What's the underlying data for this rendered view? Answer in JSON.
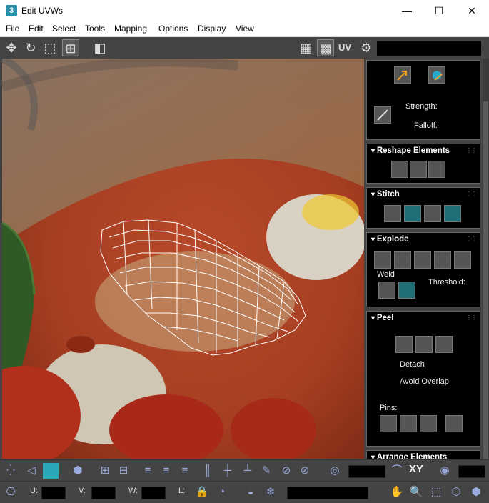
{
  "window": {
    "title": "Edit UVWs",
    "app_icon": "3",
    "minimize": "—",
    "maximize": "☐",
    "close": "✕"
  },
  "menu": [
    "File",
    "Edit",
    "Select",
    "Tools",
    "Mapping",
    "Options",
    "Display",
    "View"
  ],
  "toolbar": {
    "uv_label": "UV"
  },
  "panel": {
    "brush": {
      "strength": "Strength:",
      "falloff": "Falloff:"
    },
    "reshape": {
      "title": "Reshape Elements"
    },
    "stitch": {
      "title": "Stitch"
    },
    "explode": {
      "title": "Explode",
      "weld": "Weld",
      "threshold": "Threshold:"
    },
    "peel": {
      "title": "Peel",
      "detach": "Detach",
      "avoid_overlap": "Avoid Overlap",
      "pins": "Pins:"
    },
    "arrange": {
      "title": "Arrange Elements"
    }
  },
  "bottom": {
    "xy": "XY",
    "u": "U:",
    "v": "V:",
    "w": "W:",
    "l": "L:"
  },
  "colors": {
    "accent": "#2a8fa8",
    "teal_button": "#1f6e78",
    "panel_bg": "#444444"
  }
}
